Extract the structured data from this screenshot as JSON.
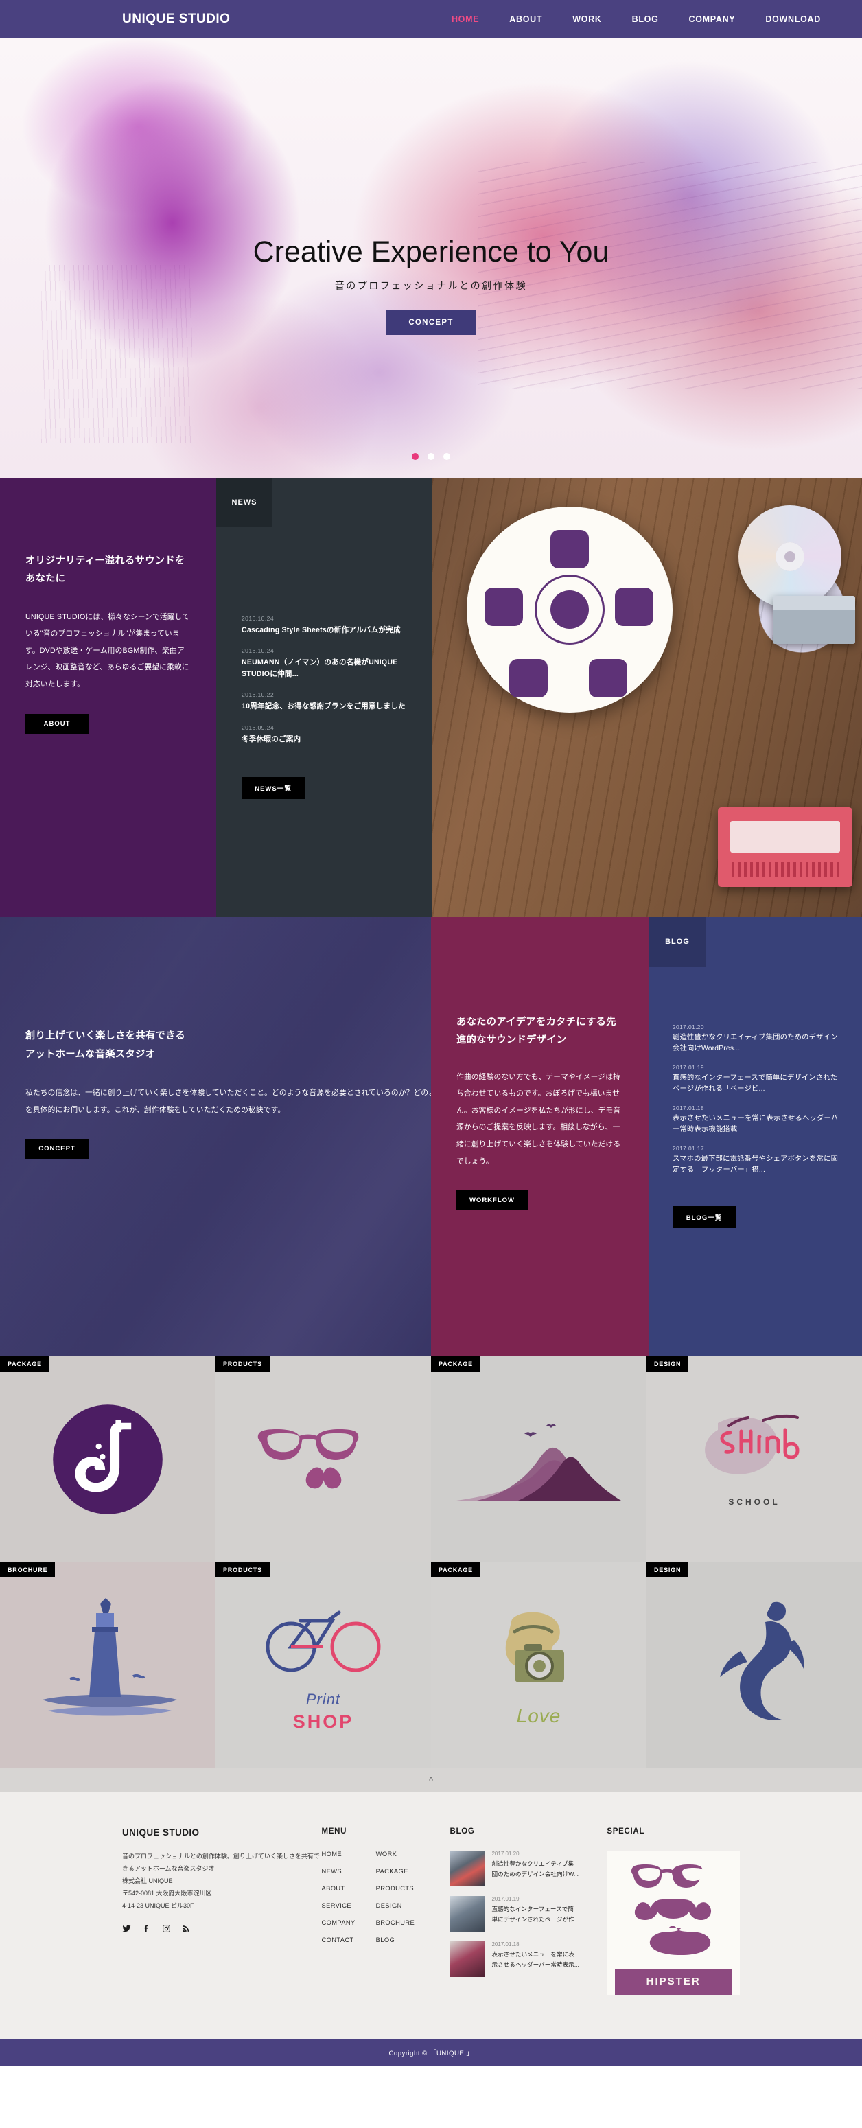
{
  "header": {
    "brand": "UNIQUE STUDIO",
    "nav": [
      {
        "label": "HOME",
        "active": true
      },
      {
        "label": "ABOUT",
        "active": false
      },
      {
        "label": "WORK",
        "active": false
      },
      {
        "label": "BLOG",
        "active": false
      },
      {
        "label": "COMPANY",
        "active": false
      },
      {
        "label": "DOWNLOAD",
        "active": false
      }
    ]
  },
  "hero": {
    "title": "Creative Experience to You",
    "subtitle": "音のプロフェッショナルとの創作体験",
    "button": "CONCEPT",
    "slides": 3,
    "active_slide": 1
  },
  "about": {
    "heading": "オリジナリティー溢れるサウンドをあなたに",
    "body": "UNIQUE STUDIOには、様々なシーンで活躍している\"音のプロフェッショナル\"が集まっています。DVDや放送・ゲーム用のBGM制作、楽曲アレンジ、映画整音など、あらゆるご要望に柔軟に対応いたします。",
    "button": "ABOUT"
  },
  "news": {
    "tab": "NEWS",
    "items": [
      {
        "date": "2016.10.24",
        "title": "Cascading Style Sheetsの新作アルバムが完成"
      },
      {
        "date": "2016.10.24",
        "title": "NEUMANN（ノイマン）のあの名機がUNIQUE STUDIOに仲間..."
      },
      {
        "date": "2016.10.22",
        "title": "10周年記念、お得な感謝プランをご用意しました"
      },
      {
        "date": "2016.09.24",
        "title": "冬季休暇のご案内"
      }
    ],
    "button": "NEWS一覧"
  },
  "concept": {
    "heading_line1": "創り上げていく楽しさを共有できる",
    "heading_line2": "アットホームな音楽スタジオ",
    "body": "私たちの信念は、一緒に創り上げていく楽しさを体験していただくこと。どのような音源を必要とされているのか？どのようなシチュエーションでご利用になるのか？イメージを具体的にお伺いします。これが、創作体験をしていただくための秘訣です。",
    "button": "CONCEPT"
  },
  "workflow": {
    "heading": "あなたのアイデアをカタチにする先進的なサウンドデザイン",
    "body": "作曲の経験のない方でも、テーマやイメージは持ち合わせているものです。おぼろげでも構いません。お客様のイメージを私たちが形にし、デモ音源からのご提案を反映します。相談しながら、一緒に創り上げていく楽しさを体験していただけるでしょう。",
    "button": "WORKFLOW"
  },
  "blog_panel": {
    "tab": "BLOG",
    "items": [
      {
        "date": "2017.01.20",
        "title": "創造性豊かなクリエイティブ集団のためのデザイン会社向けWordPres..."
      },
      {
        "date": "2017.01.19",
        "title": "直感的なインターフェースで簡単にデザインされたページが作れる「ページビ..."
      },
      {
        "date": "2017.01.18",
        "title": "表示させたいメニューを常に表示させるヘッダーバー常時表示機能搭載"
      },
      {
        "date": "2017.01.17",
        "title": "スマホの最下部に電話番号やシェアボタンを常に固定する「フッターバー」搭..."
      }
    ],
    "button": "BLOG一覧"
  },
  "gallery": [
    {
      "tag": "PACKAGE",
      "caption": ""
    },
    {
      "tag": "PRODUCTS",
      "caption": ""
    },
    {
      "tag": "PACKAGE",
      "caption": ""
    },
    {
      "tag": "DESIGN",
      "caption": "SCHOOL"
    },
    {
      "tag": "BROCHURE",
      "caption": ""
    },
    {
      "tag": "PRODUCTS",
      "caption": "SHOP"
    },
    {
      "tag": "PACKAGE",
      "caption": ""
    },
    {
      "tag": "DESIGN",
      "caption": ""
    }
  ],
  "scroll_top_icon": "chevron-up-icon",
  "footer": {
    "brand": "UNIQUE STUDIO",
    "description": "音のプロフェッショナルとの創作体験。創り上げていく楽しさを共有できるアットホームな音楽スタジオ\n株式会社 UNIQUE\n〒542-0081 大阪府大阪市淀川区\n4-14-23 UNIQUE ビル30F",
    "social": [
      "twitter-icon",
      "facebook-icon",
      "instagram-icon",
      "rss-icon"
    ],
    "menu_heading": "MENU",
    "menu_col1": [
      "HOME",
      "NEWS",
      "ABOUT",
      "SERVICE",
      "COMPANY",
      "CONTACT"
    ],
    "menu_col2": [
      "WORK",
      "PACKAGE",
      "PRODUCTS",
      "DESIGN",
      "BROCHURE",
      "BLOG"
    ],
    "blog_heading": "BLOG",
    "blog_items": [
      {
        "date": "2017.01.20",
        "title": "創造性豊かなクリエイティブ集団のためのデザイン会社向けW..."
      },
      {
        "date": "2017.01.19",
        "title": "直感的なインターフェースで簡単にデザインされたページが作..."
      },
      {
        "date": "2017.01.18",
        "title": "表示させたいメニューを常に表示させるヘッダーバー常時表示..."
      }
    ],
    "special_heading": "SPECIAL",
    "special_banner": "HIPSTER"
  },
  "copyright": "Copyright ©  「UNIQUE 」",
  "colors": {
    "header_purple": "#4a4180",
    "accent_pink": "#ef4b84",
    "about_purple": "#4b1a58",
    "news_dark": "#2b3339",
    "concept_blue": "#3a376e",
    "work_crimson": "#7d2450",
    "blog_blue": "#384179"
  }
}
